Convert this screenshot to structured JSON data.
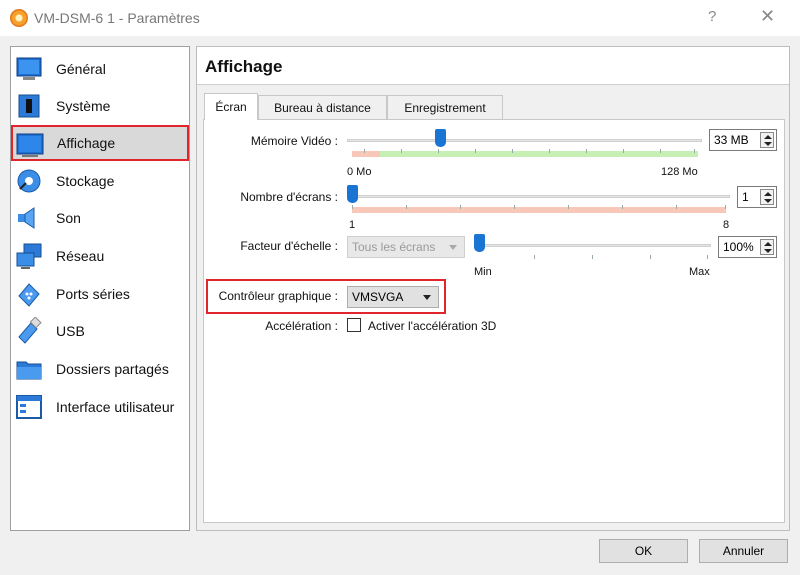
{
  "window": {
    "title": "VM-DSM-6 1 - Paramètres",
    "help": "?",
    "close": "✕"
  },
  "sidebar": {
    "items": [
      {
        "label": "Général",
        "icon": "general-icon"
      },
      {
        "label": "Système",
        "icon": "system-icon"
      },
      {
        "label": "Affichage",
        "icon": "display-icon",
        "selected": true
      },
      {
        "label": "Stockage",
        "icon": "storage-icon"
      },
      {
        "label": "Son",
        "icon": "sound-icon"
      },
      {
        "label": "Réseau",
        "icon": "network-icon"
      },
      {
        "label": "Ports séries",
        "icon": "serial-ports-icon"
      },
      {
        "label": "USB",
        "icon": "usb-icon"
      },
      {
        "label": "Dossiers partagés",
        "icon": "shared-folders-icon"
      },
      {
        "label": "Interface utilisateur",
        "icon": "user-interface-icon"
      }
    ]
  },
  "page": {
    "title": "Affichage"
  },
  "tabs": [
    {
      "label": "Écran",
      "active": true
    },
    {
      "label": "Bureau à distance"
    },
    {
      "label": "Enregistrement"
    }
  ],
  "screen": {
    "video_memory": {
      "label": "Mémoire Vidéo :",
      "value": "33 MB",
      "min": "0 Mo",
      "max": "128 Mo",
      "level": 0.26
    },
    "screens": {
      "label": "Nombre d'écrans :",
      "value": "1",
      "min": "1",
      "max": "8",
      "level": 0.0
    },
    "scale_factor": {
      "label": "Facteur d'échelle :",
      "dropdown": "Tous les écrans",
      "value": "100%",
      "min": "Min",
      "max": "Max",
      "level": 0.0
    },
    "graphics_controller": {
      "label": "Contrôleur graphique :",
      "value": "VMSVGA"
    },
    "acceleration": {
      "label": "Accélération :",
      "checkbox_label": "Activer l'accélération 3D",
      "checked": false
    }
  },
  "footer": {
    "ok": "OK",
    "cancel": "Annuler"
  },
  "colors": {
    "highlight": "#e0262a",
    "slider_thumb": "#1a74d4",
    "scale_green": "#c6efb3",
    "scale_red": "#f7c7b8"
  }
}
